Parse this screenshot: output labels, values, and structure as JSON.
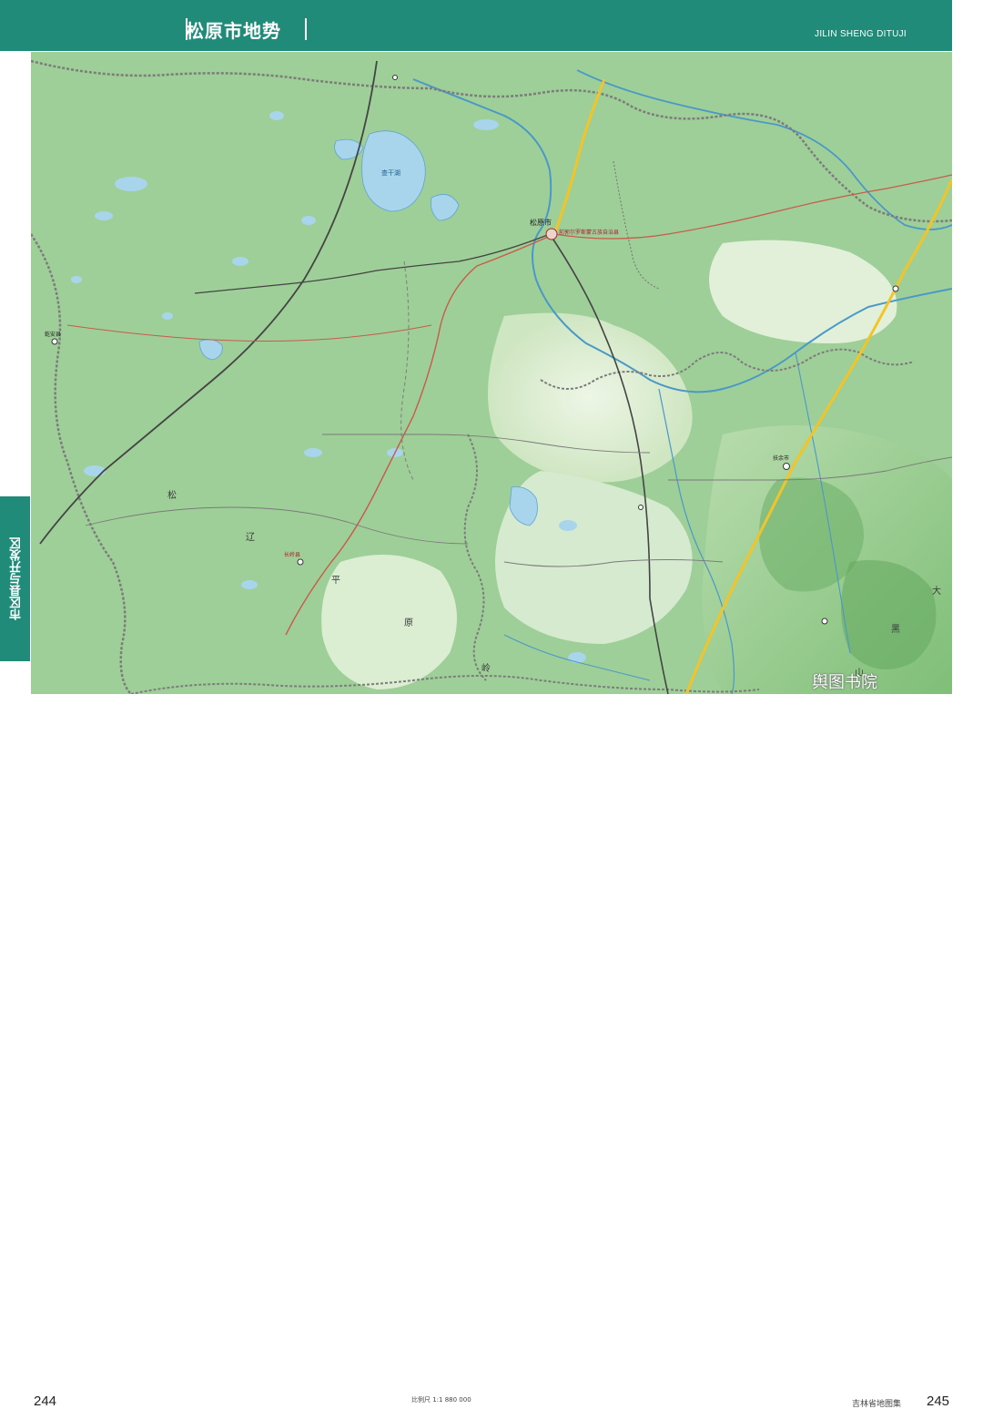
{
  "header": {
    "title": "松原市地势",
    "subtitle": "JILIN SHENG DITUJI"
  },
  "side_tab": {
    "label": "市区县与开发区"
  },
  "footer": {
    "page_left": "244",
    "page_right": "245",
    "scale": "比例尺 1:1 880 000",
    "atlas_name": "吉林省地图集"
  },
  "watermark": {
    "text": "舆图书院"
  },
  "map": {
    "colors": {
      "plain": "#9fcf98",
      "hill": "#dfeed4",
      "lake": "#a8d4ec",
      "river": "#4a98c8",
      "railway": "#444444",
      "expressway": "#f2c428",
      "road": "#c85a4a",
      "boundary": "#7c7c7c"
    },
    "labels": {
      "region_song": "松",
      "region_liao": "辽",
      "region_ping": "平",
      "region_yuan": "原",
      "region_shan": "山",
      "region_ling": "岭",
      "region_da": "大",
      "region_hei": "黑",
      "city_songyuan": "松原市",
      "county_qianan": "乾安县",
      "county_changling": "长岭县",
      "county_fuyu": "扶余市",
      "town_qianguo": "前郭尔罗斯蒙古族自治县",
      "lake_chagan": "查干湖"
    }
  }
}
